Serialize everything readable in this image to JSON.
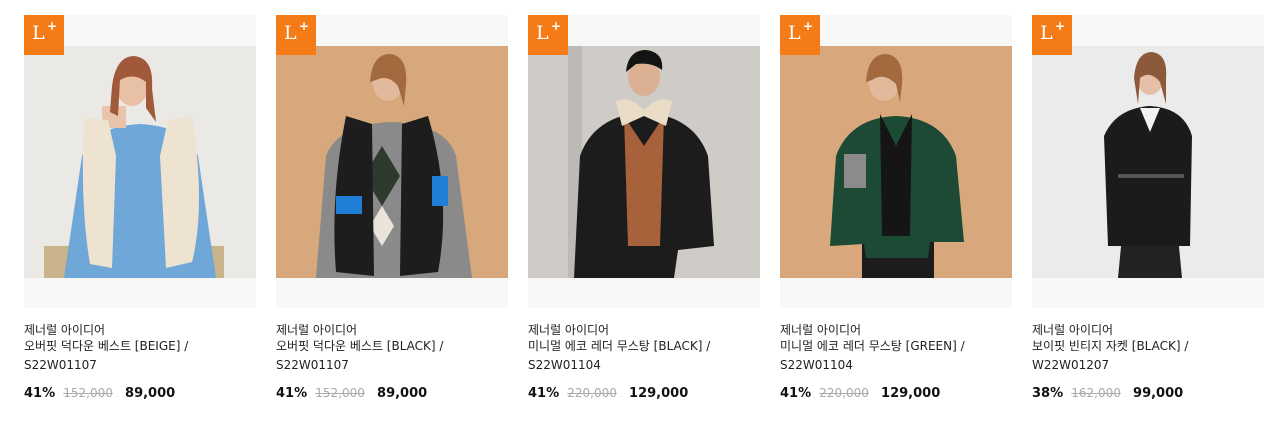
{
  "badge": {
    "letter": "L",
    "plus": "+"
  },
  "products": [
    {
      "brand": "제너럴 아이디어",
      "name": "오버핏 덕다운 베스트 [BEIGE] / S22W01107",
      "discount": "41%",
      "original_price": "152,000",
      "sale_price": "89,000",
      "image": "woman-beige-padded-vest"
    },
    {
      "brand": "제너럴 아이디어",
      "name": "오버핏 덕다운 베스트 [BLACK] / S22W01107",
      "discount": "41%",
      "original_price": "152,000",
      "sale_price": "89,000",
      "image": "woman-black-padded-vest"
    },
    {
      "brand": "제너럴 아이디어",
      "name": "미니멀 에코 레더 무스탕 [BLACK] / S22W01104",
      "discount": "41%",
      "original_price": "220,000",
      "sale_price": "129,000",
      "image": "man-black-leather-mustang"
    },
    {
      "brand": "제너럴 아이디어",
      "name": "미니멀 에코 레더 무스탕 [GREEN] / S22W01104",
      "discount": "41%",
      "original_price": "220,000",
      "sale_price": "129,000",
      "image": "woman-green-leather-mustang"
    },
    {
      "brand": "제너럴 아이디어",
      "name": "보이핏 빈티지 자켓 [BLACK] / W22W01207",
      "discount": "38%",
      "original_price": "162,000",
      "sale_price": "99,000",
      "image": "woman-black-blazer"
    }
  ],
  "colors": {
    "badge": "#f47b16",
    "text": "#222222",
    "strike": "#aaaaaa"
  }
}
